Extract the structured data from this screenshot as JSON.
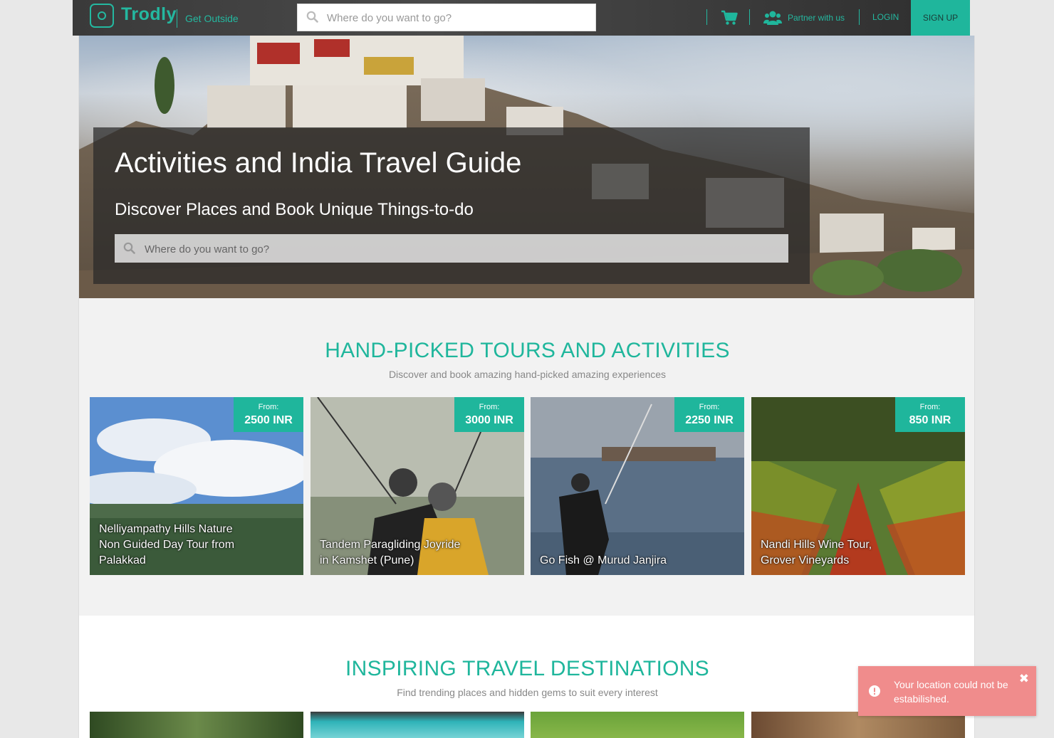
{
  "nav": {
    "logo": "Trodly",
    "tagline": "Get Outside",
    "search_placeholder": "Where do you want to go?",
    "partner_label": "Partner with us",
    "login_label": "LOGIN",
    "signup_label": "SIGN UP"
  },
  "hero": {
    "title": "Activities and India Travel Guide",
    "subtitle": "Discover Places and Book Unique Things-to-do",
    "search_placeholder": "Where do you want to go?"
  },
  "tours": {
    "title": "HAND-PICKED TOURS AND ACTIVITIES",
    "subtitle": "Discover and book amazing hand-picked amazing experiences",
    "items": [
      {
        "title": "Nelliyampathy Hills Nature Non Guided Day Tour from Palakkad",
        "price_prefix": "From:",
        "price": "2500 INR"
      },
      {
        "title": "Tandem Paragliding Joyride in Kamshet (Pune)",
        "price_prefix": "From:",
        "price": "3000 INR"
      },
      {
        "title": "Go Fish @ Murud Janjira",
        "price_prefix": "From:",
        "price": "2250 INR"
      },
      {
        "title": "Nandi Hills Wine Tour, Grover Vineyards",
        "price_prefix": "From:",
        "price": "850 INR"
      }
    ]
  },
  "destinations": {
    "title": "INSPIRING TRAVEL DESTINATIONS",
    "subtitle": "Find trending places and hidden gems to suit every interest"
  },
  "toast": {
    "message": "Your location could not be estabilished."
  },
  "colors": {
    "accent": "#1fb69c",
    "toast_bg": "#f08c8c"
  },
  "icons": [
    "search-icon",
    "cart-icon",
    "users-icon",
    "alert-icon",
    "close-icon"
  ]
}
